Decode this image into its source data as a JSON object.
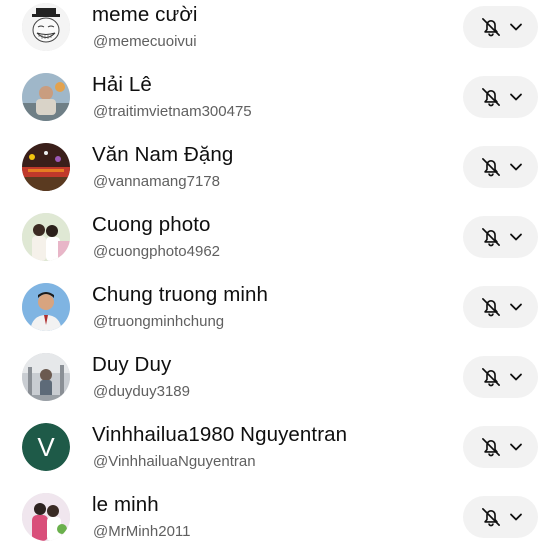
{
  "subscriptions": [
    {
      "name": "meme cười",
      "handle": "@memecuoivui",
      "avatar": "troll-face-avatar"
    },
    {
      "name": "Hải Lê",
      "handle": "@traitimvietnam300475",
      "avatar": "photo-avatar"
    },
    {
      "name": "Văn Nam Đặng",
      "handle": "@vannamang7178",
      "avatar": "photo-avatar"
    },
    {
      "name": "Cuong photo",
      "handle": "@cuongphoto4962",
      "avatar": "photo-avatar"
    },
    {
      "name": "Chung truong minh",
      "handle": "@truongminhchung",
      "avatar": "photo-avatar"
    },
    {
      "name": "Duy Duy",
      "handle": "@duyduy3189",
      "avatar": "photo-avatar"
    },
    {
      "name": "Vinhhailua1980 Nguyentran",
      "handle": "@VinhhailuaNguyentran",
      "avatar": "letter-avatar",
      "avatar_letter": "V",
      "avatar_color": "#1e5a48"
    },
    {
      "name": "le minh",
      "handle": "@MrMinh2011",
      "avatar": "photo-avatar"
    }
  ],
  "notification_icon": "bell-off-icon",
  "dropdown_icon": "chevron-down-icon",
  "colors": {
    "name_text": "#0f0f0f",
    "handle_text": "#606060",
    "button_bg": "#f2f2f2"
  }
}
